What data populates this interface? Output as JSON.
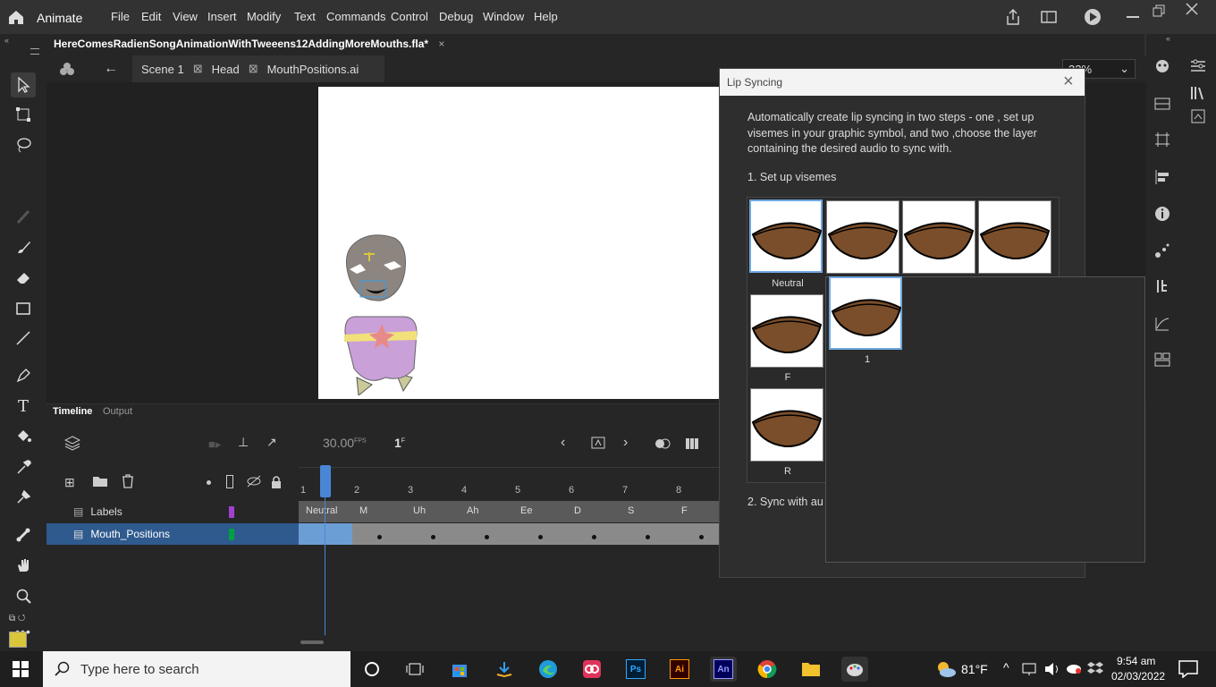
{
  "app": {
    "name": "Animate",
    "menus": [
      "File",
      "Edit",
      "View",
      "Insert",
      "Modify",
      "Text",
      "Commands",
      "Control",
      "Debug",
      "Window",
      "Help"
    ]
  },
  "document": {
    "tab_title": "HereComesRadienSongAnimationWithTweeens12AddingMoreMouths.fla*",
    "close": "×"
  },
  "breadcrumb": {
    "scene": "Scene 1",
    "symbol1": "Head",
    "symbol2": "MouthPositions.ai"
  },
  "zoom": "32%",
  "timeline": {
    "tabs": [
      "Timeline",
      "Output"
    ],
    "fps": "30.00",
    "fps_unit": "FPS",
    "frame": "1",
    "frame_unit": "F",
    "frame_numbers": [
      "1",
      "2",
      "3",
      "4",
      "5",
      "6",
      "7",
      "8"
    ],
    "layers": [
      {
        "name": "Labels",
        "color": "#a040d0"
      },
      {
        "name": "Mouth_Positions",
        "color": "#00a040"
      }
    ],
    "labels": [
      "Neutral",
      "M",
      "Uh",
      "Ah",
      "Ee",
      "D",
      "S",
      "F"
    ]
  },
  "dialog": {
    "title": "Lip Syncing",
    "close": "×",
    "description": "Automatically create lip syncing in two steps - one , set up visemes in your graphic symbol, and two ,choose the layer containing the desired audio to sync with.",
    "step1": "1. Set up visemes",
    "step2": "2. Sync with au",
    "visemes": [
      {
        "label": "Neutral"
      },
      {
        "label": ""
      },
      {
        "label": ""
      },
      {
        "label": ""
      },
      {
        "label": "F"
      },
      {
        "label": "R"
      }
    ],
    "popup_item": "1"
  },
  "taskbar": {
    "search_placeholder": "Type here to search",
    "weather": "81°F",
    "time": "9:54 am",
    "date": "02/03/2022"
  }
}
